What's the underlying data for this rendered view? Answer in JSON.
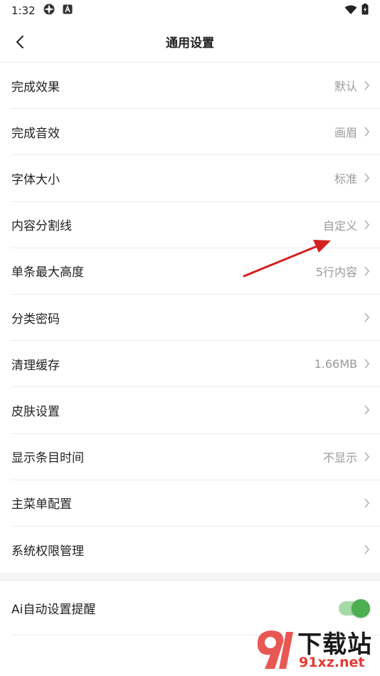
{
  "status_bar": {
    "time": "1:32"
  },
  "nav": {
    "title": "通用设置"
  },
  "settings": [
    {
      "label": "完成效果",
      "value": "默认"
    },
    {
      "label": "完成音效",
      "value": "画眉"
    },
    {
      "label": "字体大小",
      "value": "标准"
    },
    {
      "label": "内容分割线",
      "value": "自定义"
    },
    {
      "label": "单条最大高度",
      "value": "5行内容"
    },
    {
      "label": "分类密码",
      "value": ""
    },
    {
      "label": "清理缓存",
      "value": "1.66MB"
    },
    {
      "label": "皮肤设置",
      "value": ""
    },
    {
      "label": "显示条目时间",
      "value": "不显示"
    },
    {
      "label": "主菜单配置",
      "value": ""
    },
    {
      "label": "系统权限管理",
      "value": ""
    }
  ],
  "toggle_setting": {
    "label": "Ai自动设置提醒",
    "enabled": true
  },
  "watermark": {
    "title": "下载站",
    "domain": "91xz.net"
  },
  "colors": {
    "accent_green": "#4caf50",
    "annotation_red": "#d32020"
  }
}
